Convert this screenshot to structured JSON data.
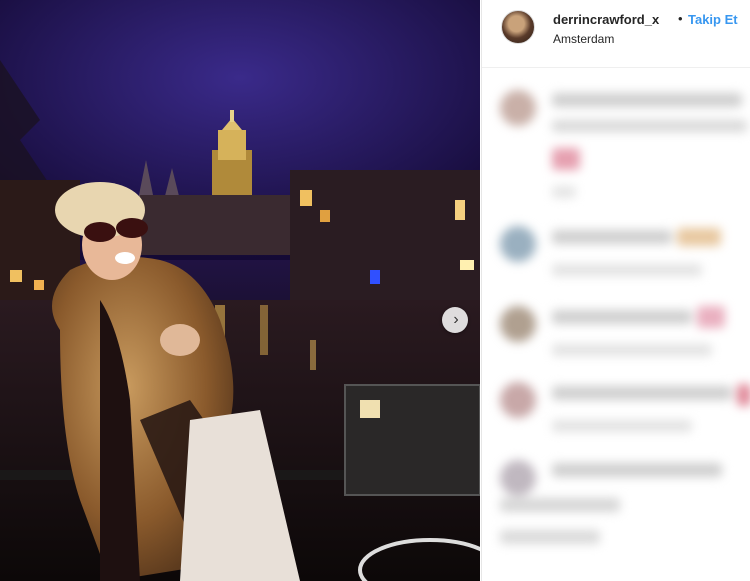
{
  "post": {
    "username": "derrincrawford_x",
    "separator": "•",
    "follow_label": "Takip Et",
    "location": "Amsterdam"
  },
  "icons": {
    "avatar": "profile-avatar",
    "next": "chevron-right-icon"
  },
  "colors": {
    "follow": "#3897f0",
    "text": "#262626"
  }
}
